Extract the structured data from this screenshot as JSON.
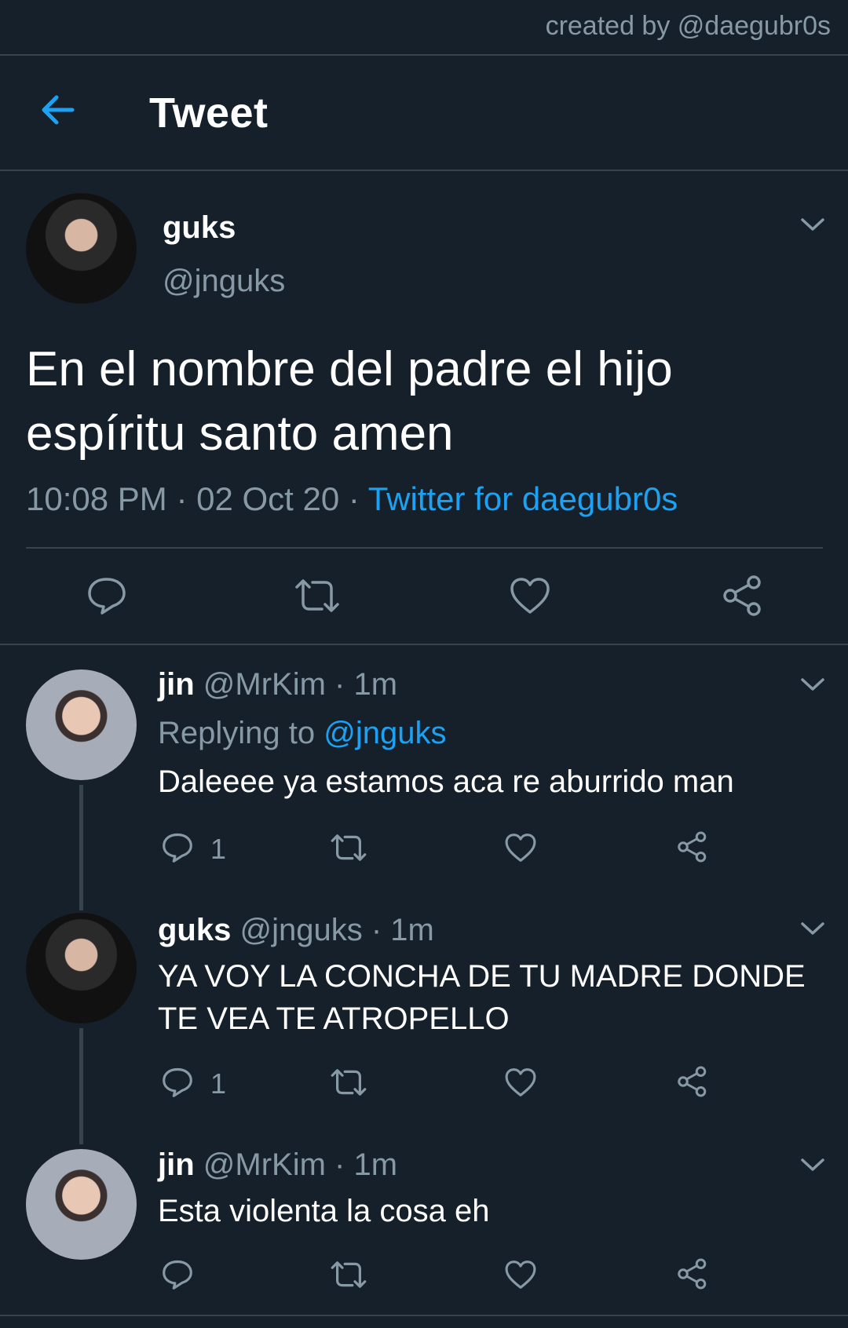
{
  "credit": "created by @daegubr0s",
  "header": {
    "title": "Tweet",
    "back_icon": "arrow-left-icon"
  },
  "colors": {
    "background": "#15202b",
    "accent": "#1da1f2",
    "muted": "#8899a6",
    "divider": "#38444d"
  },
  "main_tweet": {
    "name": "guks",
    "handle": "@jnguks",
    "text_line1": "En el nombre del padre el hijo",
    "text_line2": "espíritu santo amen",
    "time": "10:08 PM · 02 Oct 20 · ",
    "source": "Twitter for daegubr0s"
  },
  "replies": [
    {
      "name": "jin",
      "handle": "@MrKim · 1m",
      "replying_prefix": "Replying to ",
      "replying_to": "@jnguks",
      "text": "Daleeee ya estamos aca re aburrido man",
      "reply_count": "1"
    },
    {
      "name": "guks",
      "handle": "@jnguks · 1m",
      "text_line1": "YA VOY LA CONCHA DE TU MADRE DONDE",
      "text_line2": "TE VEA TE ATROPELLO",
      "reply_count": "1"
    },
    {
      "name": "jin",
      "handle": "@MrKim · 1m",
      "text": "Esta violenta la cosa eh",
      "reply_count": ""
    }
  ]
}
